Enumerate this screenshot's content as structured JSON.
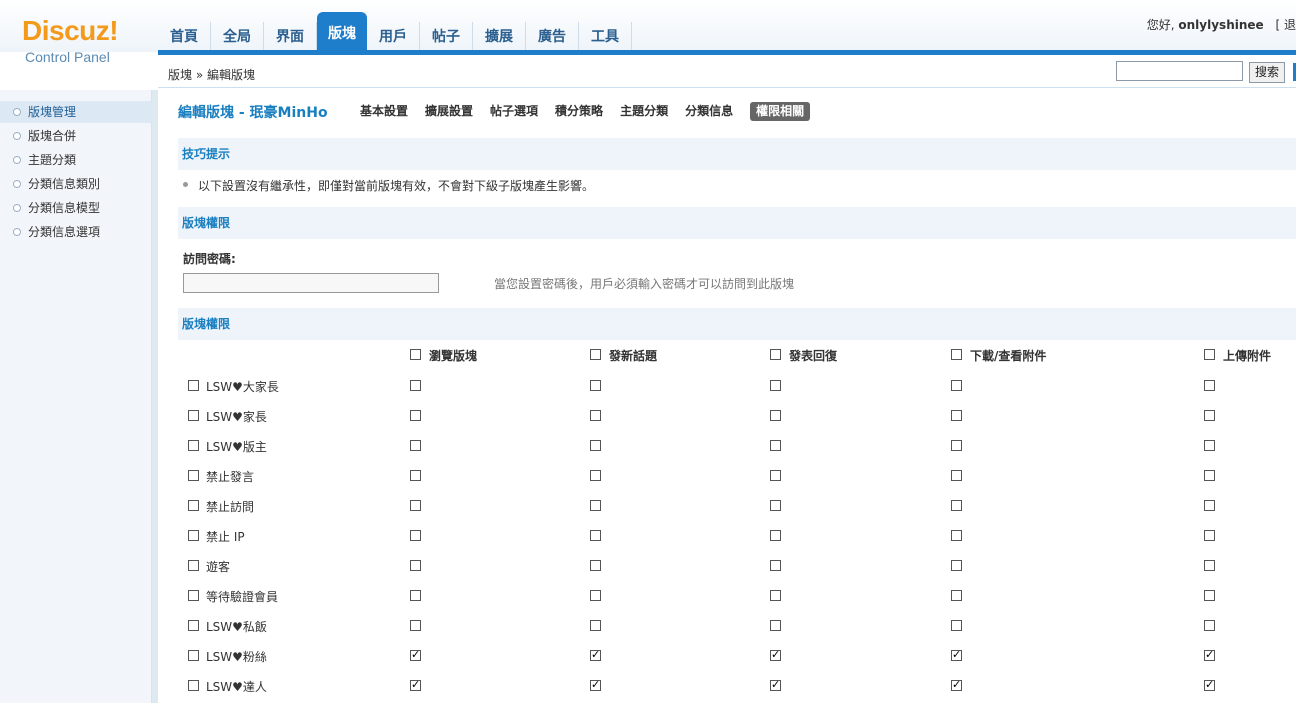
{
  "logo": {
    "main": "Discuz!",
    "sub": "Control Panel"
  },
  "nav": [
    "首頁",
    "全局",
    "界面",
    "版塊",
    "用戶",
    "帖子",
    "擴展",
    "廣告",
    "工具"
  ],
  "nav_active": 3,
  "user": {
    "greeting": "您好,",
    "name": "onlylyshinee",
    "bracket": "[ 退"
  },
  "breadcrumb": "版塊 » 編輯版塊",
  "search": {
    "button": "搜索",
    "value": ""
  },
  "sidebar": [
    "版塊管理",
    "版塊合併",
    "主題分類",
    "分類信息類別",
    "分類信息模型",
    "分類信息選項"
  ],
  "sidebar_active": 0,
  "page_title": "編輯版塊 - 珉豪MinHo",
  "subtabs": [
    "基本設置",
    "擴展設置",
    "帖子選項",
    "積分策略",
    "主題分類",
    "分類信息",
    "權限相關"
  ],
  "subtab_active": 6,
  "tips": {
    "title": "技巧提示",
    "text": "以下設置沒有繼承性，即僅對當前版塊有效，不會對下級子版塊產生影響。"
  },
  "access": {
    "title": "版塊權限",
    "label": "訪問密碼:",
    "value": "",
    "hint": "當您設置密碼後，用戶必須輸入密碼才可以訪問到此版塊"
  },
  "perms": {
    "title": "版塊權限",
    "columns": [
      "瀏覽版塊",
      "發新話題",
      "發表回復",
      "下載/查看附件",
      "上傳附件"
    ],
    "rows": [
      {
        "name": "LSW♥大家長",
        "values": [
          false,
          false,
          false,
          false,
          false
        ]
      },
      {
        "name": "LSW♥家長",
        "values": [
          false,
          false,
          false,
          false,
          false
        ]
      },
      {
        "name": "LSW♥版主",
        "values": [
          false,
          false,
          false,
          false,
          false
        ]
      },
      {
        "name": "禁止發言",
        "values": [
          false,
          false,
          false,
          false,
          false
        ]
      },
      {
        "name": "禁止訪問",
        "values": [
          false,
          false,
          false,
          false,
          false
        ]
      },
      {
        "name": "禁止 IP",
        "values": [
          false,
          false,
          false,
          false,
          false
        ]
      },
      {
        "name": "遊客",
        "values": [
          false,
          false,
          false,
          false,
          false
        ]
      },
      {
        "name": "等待驗證會員",
        "values": [
          false,
          false,
          false,
          false,
          false
        ]
      },
      {
        "name": "LSW♥私飯",
        "values": [
          false,
          false,
          false,
          false,
          false
        ]
      },
      {
        "name": "LSW♥粉絲",
        "values": [
          true,
          true,
          true,
          true,
          true
        ]
      },
      {
        "name": "LSW♥達人",
        "values": [
          true,
          true,
          true,
          true,
          true
        ]
      }
    ]
  },
  "colors": {
    "accent": "#1f7ecb",
    "logo": "#f39a1c",
    "title": "#1a7fc1"
  }
}
